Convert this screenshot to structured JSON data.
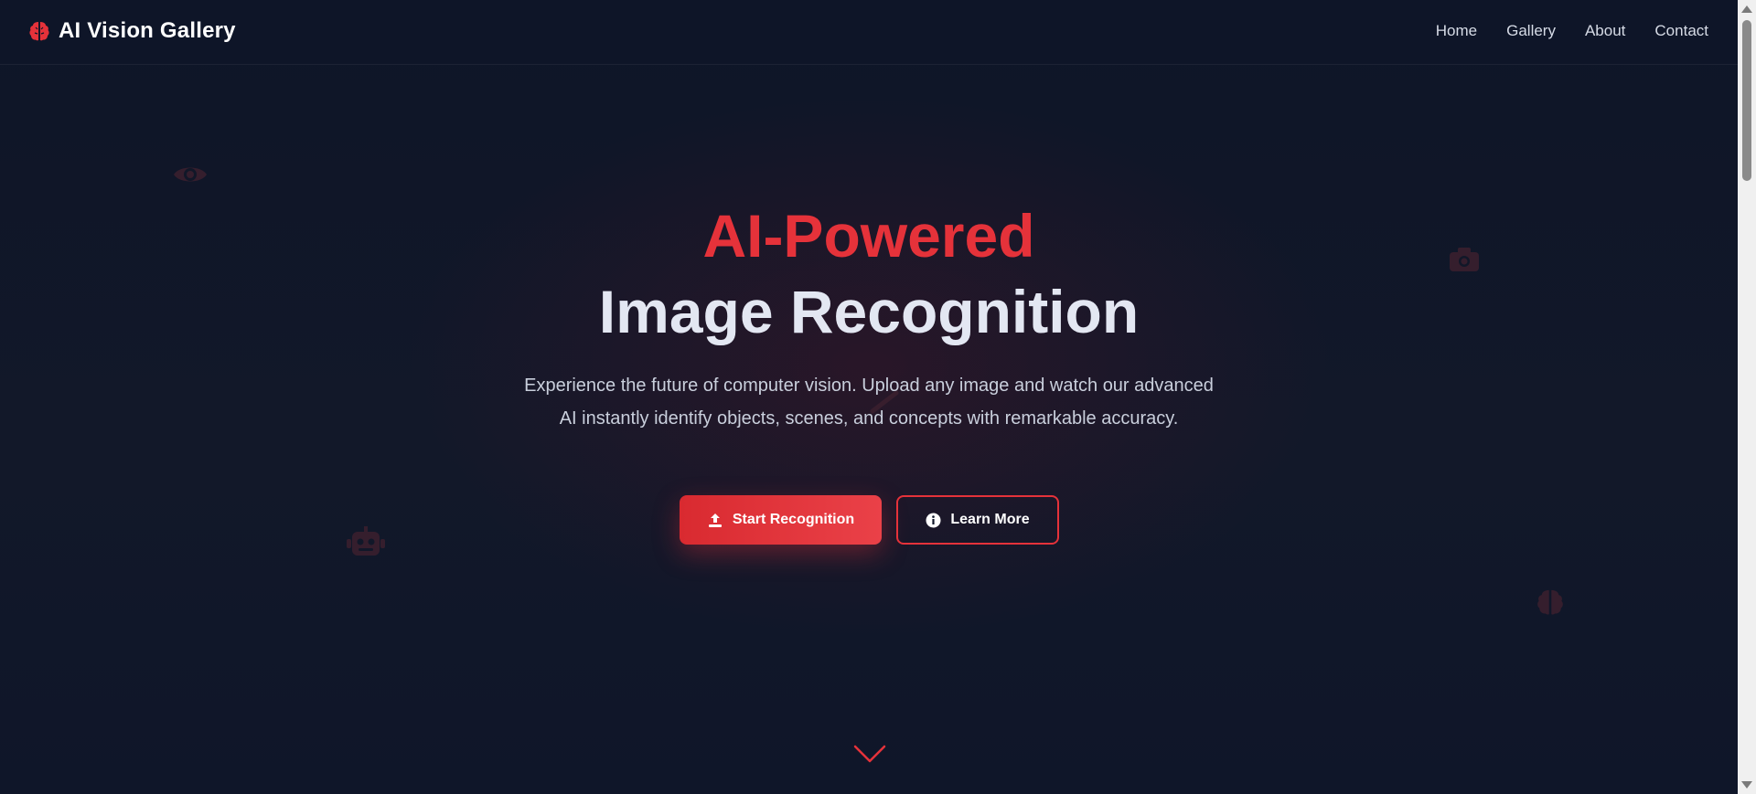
{
  "colors": {
    "accent": "#e5323a",
    "background": "#0f1629",
    "text_light": "#e3e7f2",
    "text_muted": "#c9cfdc"
  },
  "navbar": {
    "brand_icon": "brain-icon",
    "brand_title": "AI Vision Gallery",
    "links": [
      {
        "label": "Home"
      },
      {
        "label": "Gallery"
      },
      {
        "label": "About"
      },
      {
        "label": "Contact"
      }
    ]
  },
  "hero": {
    "title_accent": "AI-Powered",
    "title_main": "Image Recognition",
    "description": "Experience the future of computer vision. Upload any image and watch our advanced AI instantly identify objects, scenes, and concepts with remarkable accuracy.",
    "primary_button": {
      "label": "Start Recognition",
      "icon": "upload-icon"
    },
    "secondary_button": {
      "label": "Learn More",
      "icon": "info-circle-icon"
    },
    "decorative_icons": [
      "eye-icon",
      "camera-icon",
      "robot-icon",
      "brain-icon",
      "magic-wand-icon"
    ],
    "scroll_indicator": "chevron-down-icon"
  }
}
